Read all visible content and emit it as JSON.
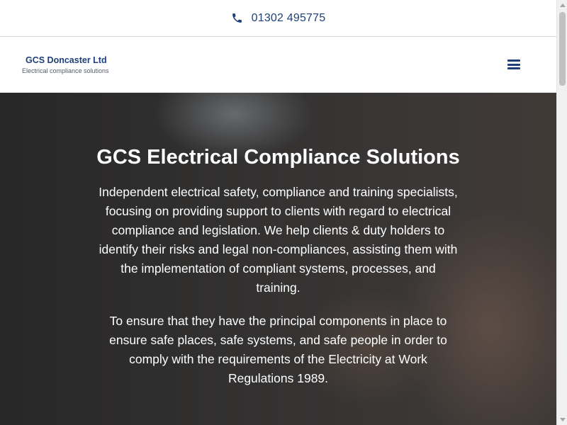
{
  "topbar": {
    "phone_icon": "phone-icon",
    "phone_number": "01302 495775"
  },
  "header": {
    "logo_title": "GCS Doncaster Ltd",
    "logo_subtitle": "Electrical compliance solutions",
    "menu_icon": "hamburger-menu-icon"
  },
  "hero": {
    "title": "GCS Electrical Compliance Solutions",
    "paragraph1": "Independent electrical safety, compliance and training specialists, focusing on providing support to clients with regard to electrical compliance and legislation. We help clients & duty holders to identify their risks and legal non-compliances, assisting them with the implementation of compliant systems, processes, and training.",
    "paragraph2": "To ensure that they have the principal components in place to ensure safe places, safe systems, and safe people in order to comply with the requirements of the Electricity at Work Regulations 1989."
  },
  "colors": {
    "brand": "#1e3f78",
    "hero_text": "#ffffff",
    "scrollbar_track": "#f1f1f1",
    "scrollbar_thumb": "#c1c1c1"
  }
}
